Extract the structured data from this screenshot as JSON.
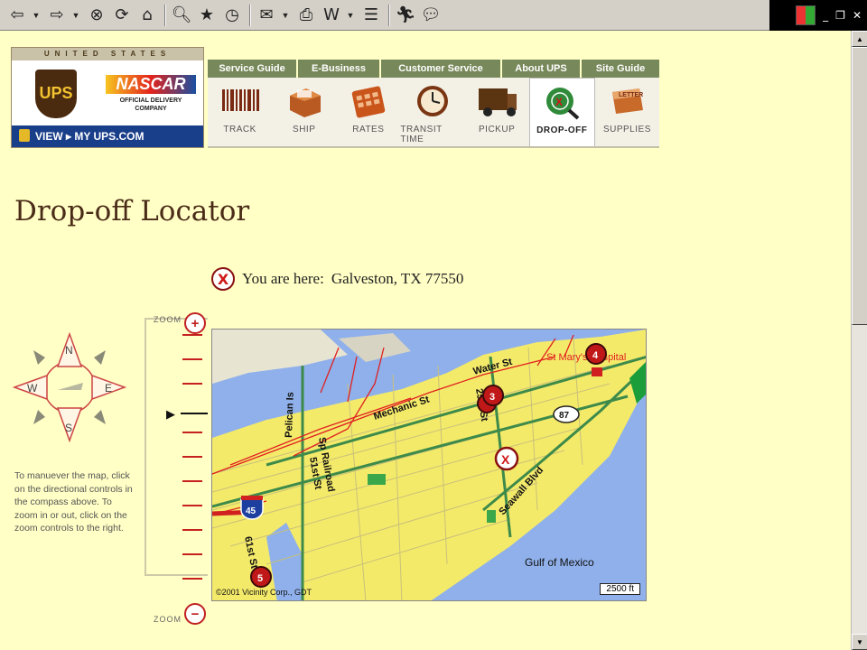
{
  "browser": {
    "toolbar_icons": [
      "back-icon",
      "forward-icon",
      "stop-icon",
      "refresh-icon",
      "home-icon",
      "search-icon",
      "favorites-icon",
      "history-icon",
      "mail-icon",
      "print-icon",
      "edit-icon",
      "discuss-icon",
      "messenger-icon",
      "chat-icon"
    ]
  },
  "header": {
    "brand_top": "UNITED STATES",
    "ups_logo": "UPS",
    "nascar_logo": "NASCAR",
    "nascar_sub": "OFFICIAL DELIVERY COMPANY",
    "view_link": "VIEW ▸ MY UPS.COM",
    "tabs": [
      {
        "label": "Service Guide"
      },
      {
        "label": "E-Business"
      },
      {
        "label": "Customer Service"
      },
      {
        "label": "About UPS"
      },
      {
        "label": "Site Guide"
      }
    ],
    "tools": [
      {
        "label": "TRACK",
        "icon": "barcode-icon"
      },
      {
        "label": "SHIP",
        "icon": "package-icon"
      },
      {
        "label": "RATES",
        "icon": "calculator-icon"
      },
      {
        "label": "TRANSIT TIME",
        "icon": "clock-icon"
      },
      {
        "label": "PICKUP",
        "icon": "truck-icon"
      },
      {
        "label": "DROP-OFF",
        "icon": "globe-magnifier-icon"
      },
      {
        "label": "SUPPLIES",
        "icon": "letter-box-icon"
      }
    ]
  },
  "page": {
    "title": "Drop-off Locator",
    "here_label": "You are here:",
    "here_value": "Galveston, TX 77550",
    "instructions": "To manuever the map, click on the directional controls in the compass above. To zoom in or out, click on the zoom controls to the right."
  },
  "compass": {
    "n": "N",
    "s": "S",
    "e": "E",
    "w": "W"
  },
  "zoom": {
    "top_label": "ZOOM",
    "bottom_label": "ZOOM",
    "plus": "+",
    "minus": "−",
    "level": 4,
    "levels": 11
  },
  "map": {
    "labels": {
      "water_st": "Water St",
      "mechanic_st": "Mechanic St",
      "pelican_is": "Pelican Is",
      "sp_railroad": "Sp Railroad",
      "st_51": "51st St",
      "st_61": "61st St",
      "st_25": "25th St",
      "seawall": "Seawall Blvd",
      "hospital": "St Mary's Hospital",
      "gulf": "Gulf of Mexico",
      "i45": "45",
      "r87": "87"
    },
    "markers": [
      "3",
      "4",
      "5"
    ],
    "scale": "2500 ft",
    "copyright": "©2001 Vicinity Corp., GDT"
  }
}
